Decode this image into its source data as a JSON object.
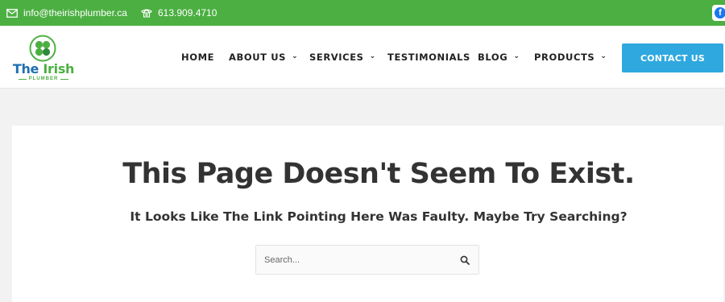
{
  "topbar": {
    "email": "info@theirishplumber.ca",
    "phone": "613.909.4710",
    "bg_color": "#4caf42",
    "email_icon": "mail-icon",
    "phone_icon": "phone-icon",
    "social_icon": "facebook-icon"
  },
  "logo": {
    "word1": "The",
    "word2": "Irish",
    "sub": "PLUMBER",
    "icon": "shamrock-icon"
  },
  "nav": {
    "items": [
      {
        "label": "HOME",
        "has_dropdown": false
      },
      {
        "label": "ABOUT US",
        "has_dropdown": true
      },
      {
        "label": "SERVICES",
        "has_dropdown": true
      },
      {
        "label": "TESTIMONIALS",
        "has_dropdown": false
      },
      {
        "label": "BLOG",
        "has_dropdown": true
      },
      {
        "label": "PRODUCTS",
        "has_dropdown": true
      }
    ],
    "chevron": "⌄"
  },
  "cta": {
    "label": "CONTACT US",
    "color": "#2fa8e0"
  },
  "main": {
    "title": "This Page Doesn't Seem To Exist.",
    "subtitle": "It Looks Like The Link Pointing Here Was Faulty. Maybe Try Searching?"
  },
  "search": {
    "placeholder": "Search...",
    "value": "",
    "icon": "search-icon"
  }
}
